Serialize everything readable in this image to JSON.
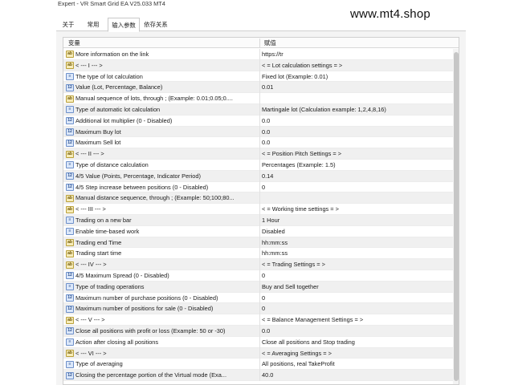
{
  "window": {
    "title": "Expert - VR Smart Grid EA V25.033 MT4"
  },
  "watermark": "www.mt4.shop",
  "tabs": [
    {
      "label": "关于"
    },
    {
      "label": "常用"
    },
    {
      "label": "输入参数",
      "active": true
    },
    {
      "label": "依存关系"
    }
  ],
  "table": {
    "headers": {
      "variable": "变量",
      "value": "赋值"
    },
    "rows": [
      {
        "icon": "ab",
        "name": "More information on the link",
        "value": "https://tr"
      },
      {
        "icon": "ab",
        "name": "< --- I --- >",
        "value": "< = Lot calculation settings = >"
      },
      {
        "icon": "enum",
        "name": "The type of lot calculation",
        "value": "Fixed lot (Example: 0.01)"
      },
      {
        "icon": "num",
        "name": "Value (Lot, Percentage, Balance)",
        "value": "0.01"
      },
      {
        "icon": "ab",
        "name": "Manual sequence of lots, through ; (Example: 0.01;0.05;0....",
        "value": ""
      },
      {
        "icon": "enum",
        "name": "Type of automatic lot calculation",
        "value": "Martingale lot (Calculation example: 1,2,4,8,16)"
      },
      {
        "icon": "num",
        "name": "Additional lot multiplier (0 - Disabled)",
        "value": "0.0"
      },
      {
        "icon": "num",
        "name": "Maximum Buy lot",
        "value": "0.0"
      },
      {
        "icon": "num",
        "name": "Maximum Sell lot",
        "value": "0.0"
      },
      {
        "icon": "ab",
        "name": "< --- II --- >",
        "value": "< = Position Pitch Settings = >"
      },
      {
        "icon": "enum",
        "name": "Type of distance calculation",
        "value": "Percentages (Example: 1.5)"
      },
      {
        "icon": "num",
        "name": "4/5 Value (Points, Percentage, Indicator Period)",
        "value": "0.14"
      },
      {
        "icon": "num",
        "name": "4/5 Step increase between positions (0 - Disabled)",
        "value": "0"
      },
      {
        "icon": "ab",
        "name": "Manual distance sequence, through ; (Example: 50;100;80...",
        "value": ""
      },
      {
        "icon": "ab",
        "name": "< --- III --- >",
        "value": "< = Working time settings = >"
      },
      {
        "icon": "enum",
        "name": "Trading on a new bar",
        "value": "1 Hour"
      },
      {
        "icon": "enum",
        "name": "Enable time-based work",
        "value": "Disabled"
      },
      {
        "icon": "ab",
        "name": "Trading end Time",
        "value": "hh:mm:ss"
      },
      {
        "icon": "ab",
        "name": "Trading start time",
        "value": "hh:mm:ss"
      },
      {
        "icon": "ab",
        "name": "< --- IV --- >",
        "value": "< = Trading Settings = >"
      },
      {
        "icon": "num",
        "name": "4/5 Maximum Spread (0 - Disabled)",
        "value": "0"
      },
      {
        "icon": "enum",
        "name": "Type of trading operations",
        "value": "Buy and Sell together"
      },
      {
        "icon": "num",
        "name": "Maximum number of purchase positions (0 - Disabled)",
        "value": "0"
      },
      {
        "icon": "num",
        "name": "Maximum number of positions for sale (0 - Disabled)",
        "value": "0"
      },
      {
        "icon": "ab",
        "name": "< --- V --- >",
        "value": "< = Balance Management Settings = >"
      },
      {
        "icon": "num",
        "name": "Close all positions with profit or loss (Example: 50 or -30)",
        "value": "0.0"
      },
      {
        "icon": "enum",
        "name": "Action after closing all positions",
        "value": "Close all positions and Stop trading"
      },
      {
        "icon": "ab",
        "name": "< --- VI --- >",
        "value": "< = Averaging Settings = >"
      },
      {
        "icon": "enum",
        "name": "Type of averaging",
        "value": "All positions, real TakeProfit"
      },
      {
        "icon": "num",
        "name": "Closing the percentage portion of the Virtual mode (Exa...",
        "value": "40.0"
      }
    ]
  }
}
